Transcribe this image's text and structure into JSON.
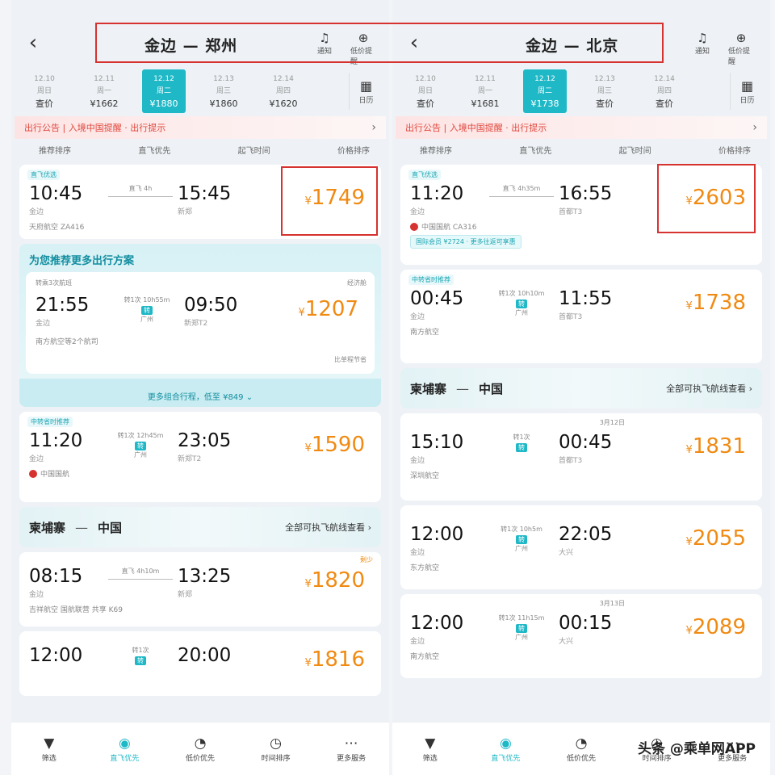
{
  "left": {
    "route": "金边 — 郑州",
    "header_icons": [
      {
        "glyph": "♫",
        "label": "通知"
      },
      {
        "glyph": "⊕",
        "label": "低价提醒"
      }
    ],
    "dates": [
      {
        "d1": "12.10",
        "d2": "周日",
        "price": "查价"
      },
      {
        "d1": "12.11",
        "d2": "周一",
        "price": "¥1662"
      },
      {
        "d1": "12.12",
        "d2": "周二",
        "price": "¥1880"
      },
      {
        "d1": "12.13",
        "d2": "周三",
        "price": "¥1860"
      },
      {
        "d1": "12.14",
        "d2": "周四",
        "price": "¥1620"
      }
    ],
    "calendar_label": "日历",
    "notice": "出行公告 | 入境中国提醒 · 出行提示",
    "sorts": [
      "推荐排序",
      "直飞优先",
      "起飞时间",
      "价格排序"
    ],
    "first": {
      "tag": "直飞优选",
      "dep": "10:45",
      "dep_ap": "金边",
      "mid": "直飞 4h",
      "arr": "15:45",
      "arr_ap": "新郑",
      "price": "1749",
      "airline": "天府航空 ZA416"
    },
    "reco_title": "为您推荐更多出行方案",
    "reco": {
      "note": "转乘3次航班",
      "right_note": "经济舱",
      "dep": "21:55",
      "dep_ap": "金边",
      "mid": "转1次 10h55m",
      "stop": "转",
      "stop_city": "广州",
      "arr": "09:50",
      "arr_ap": "新郑T2",
      "price": "1207",
      "airline": "南方航空等2个航司",
      "airline_right": "比单程节省"
    },
    "reco_more": "更多组合行程，低至 ¥849 ⌄",
    "second": {
      "tag": "中转省时推荐",
      "dep": "11:20",
      "dep_ap": "金边",
      "mid": "转1次 12h45m",
      "stop": "转",
      "stop_city": "广州",
      "arr": "23:05",
      "arr_ap": "新郑T2",
      "price": "1590",
      "airline": "中国国航"
    },
    "banner": {
      "from": "柬埔寨",
      "to": "中国",
      "link": "全部可执飞航线查看 ›"
    },
    "third": {
      "tag_right": "剩少",
      "dep": "08:15",
      "dep_ap": "金边",
      "mid": "直飞 4h10m",
      "arr": "13:25",
      "arr_ap": "新郑",
      "price": "1820",
      "airline": "吉祥航空 国航联营 共享 K69"
    },
    "fourth": {
      "dep": "12:00",
      "mid": "转1次",
      "stop": "转",
      "arr": "20:00",
      "price": "1816"
    }
  },
  "right": {
    "route": "金边 — 北京",
    "header_icons": [
      {
        "glyph": "♫",
        "label": "通知"
      },
      {
        "glyph": "⊕",
        "label": "低价提醒"
      }
    ],
    "dates": [
      {
        "d1": "12.10",
        "d2": "周日",
        "price": "查价"
      },
      {
        "d1": "12.11",
        "d2": "周一",
        "price": "¥1681"
      },
      {
        "d1": "12.12",
        "d2": "周二",
        "price": "¥1738"
      },
      {
        "d1": "12.13",
        "d2": "周三",
        "price": "查价"
      },
      {
        "d1": "12.14",
        "d2": "周四",
        "price": "查价"
      }
    ],
    "calendar_label": "日历",
    "notice": "出行公告 | 入境中国提醒 · 出行提示",
    "sorts": [
      "推荐排序",
      "直飞优先",
      "起飞时间",
      "价格排序"
    ],
    "first": {
      "tag": "直飞优选",
      "dep": "11:20",
      "dep_ap": "金边",
      "mid": "直飞 4h35m",
      "arr": "16:55",
      "arr_ap": "首都T3",
      "price": "2603",
      "airline": "中国国航 CA316",
      "badge": "国际会员 ¥2724 · 更多往返可享惠"
    },
    "second": {
      "tag": "中转省时推荐",
      "dep": "00:45",
      "dep_ap": "金边",
      "mid": "转1次 10h10m",
      "stop": "转",
      "stop_city": "广州",
      "arr": "11:55",
      "arr_ap": "首都T3",
      "price": "1738",
      "airline": "南方航空"
    },
    "banner": {
      "from": "柬埔寨",
      "to": "中国",
      "link": "全部可执飞航线查看 ›"
    },
    "third": {
      "next_day": "3月12日",
      "dep": "15:10",
      "dep_ap": "金边",
      "mid": "转1次",
      "stop": "转",
      "arr": "00:45",
      "arr_ap": "首都T3",
      "price": "1831",
      "airline": "深圳航空"
    },
    "fourth": {
      "dep": "12:00",
      "dep_ap": "金边",
      "mid": "转1次 10h5m",
      "stop": "转",
      "stop_city": "广州",
      "arr": "22:05",
      "arr_ap": "大兴",
      "price": "2055",
      "airline": "东方航空"
    },
    "fifth": {
      "next_day": "3月13日",
      "dep": "12:00",
      "dep_ap": "金边",
      "mid": "转1次 11h15m",
      "stop": "转",
      "stop_city": "广州",
      "arr": "00:15",
      "arr_ap": "大兴",
      "price": "2089",
      "airline": "南方航空"
    }
  },
  "tabs": [
    {
      "glyph": "▼",
      "label": "筛选"
    },
    {
      "glyph": "◉",
      "label": "直飞优先"
    },
    {
      "glyph": "◔",
      "label": "低价优先"
    },
    {
      "glyph": "◷",
      "label": "时间排序"
    },
    {
      "glyph": "⋯",
      "label": "更多服务"
    }
  ],
  "watermark": "头条 @乘单网APP",
  "colors": {
    "accent": "#1fb8c7",
    "price": "#f08a12",
    "highlight_box": "#d6322f"
  }
}
